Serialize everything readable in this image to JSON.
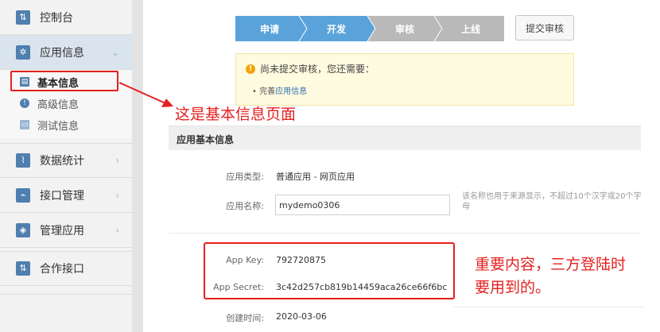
{
  "sidebar": {
    "items": [
      {
        "label": "控制台",
        "icon": "sliders-icon"
      },
      {
        "label": "应用信息",
        "icon": "gear-icon"
      },
      {
        "label": "数据统计",
        "icon": "chart-icon"
      },
      {
        "label": "接口管理",
        "icon": "plug-icon"
      },
      {
        "label": "管理应用",
        "icon": "layers-icon"
      },
      {
        "label": "合作接口",
        "icon": "sliders-icon"
      }
    ],
    "sub_items": [
      {
        "label": "基本信息",
        "icon": "id-card-icon"
      },
      {
        "label": "高级信息",
        "icon": "info-icon"
      },
      {
        "label": "测试信息",
        "icon": "test-card-icon"
      }
    ]
  },
  "steps": [
    "申请",
    "开发",
    "审核",
    "上线"
  ],
  "submit_label": "提交审核",
  "notice": {
    "title": "尚未提交审核，您还需要：",
    "item_prefix": "完善",
    "item_link": "应用信息"
  },
  "annotations": {
    "left": "这是基本信息页面",
    "right_line1": "重要内容，三方登陆时",
    "right_line2": "要用到的。"
  },
  "section": {
    "title": "应用基本信息",
    "type_label": "应用类型:",
    "type_value": "普通应用 - 网页应用",
    "name_label": "应用名称:",
    "name_value": "mydemo0306",
    "name_hint": "该名称也用于来源显示，不超过10个汉字或20个字母",
    "key_label": "App Key:",
    "key_value": "792720875",
    "secret_label": "App Secret:",
    "secret_value": "3c42d257cb819b14459aca26ce66f6bc",
    "created_label": "创建时间:",
    "created_value": "2020-03-06"
  },
  "colors": {
    "step_done": "#5aa3da",
    "step_pending": "#b9b9b9",
    "annotation_red": "#e62020",
    "nav_active": "#d9e4ee"
  }
}
